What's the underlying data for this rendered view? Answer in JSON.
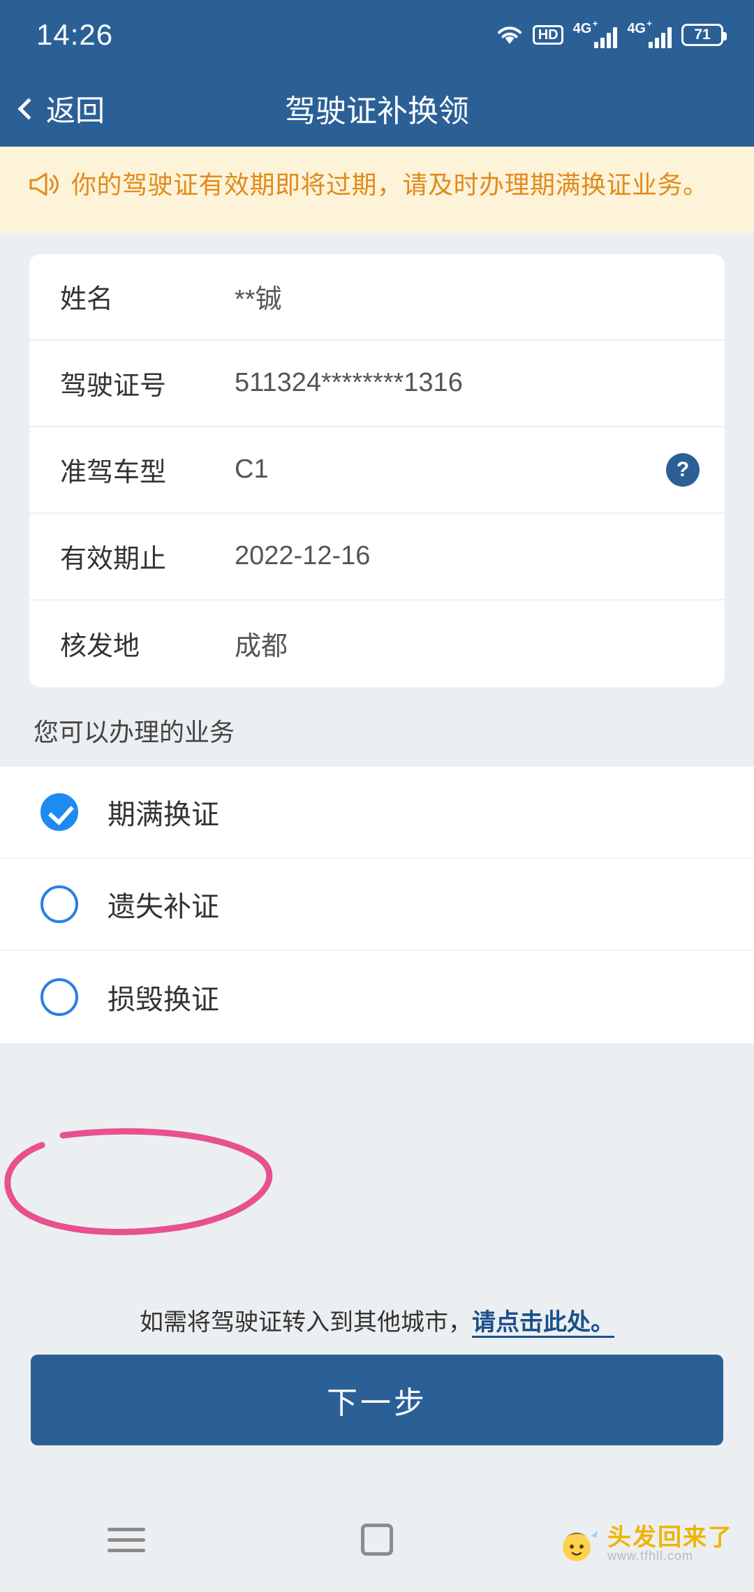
{
  "status_bar": {
    "time": "14:26",
    "wifi_icon": "wifi-icon",
    "hd_label": "HD",
    "net_label_1": "4G",
    "net_sup_1": "+",
    "net_label_2": "4G",
    "net_sup_2": "+",
    "battery": "71"
  },
  "app_bar": {
    "back_label": "返回",
    "title": "驾驶证补换领"
  },
  "notice": {
    "icon": "megaphone-icon",
    "text": "你的驾驶证有效期即将过期，请及时办理期满换证业务。"
  },
  "info_card": {
    "rows": [
      {
        "label": "姓名",
        "value": "**铖",
        "help": ""
      },
      {
        "label": "驾驶证号",
        "value": "511324********1316",
        "help": ""
      },
      {
        "label": "准驾车型",
        "value": "C1",
        "help": "?"
      },
      {
        "label": "有效期止",
        "value": "2022-12-16",
        "help": ""
      },
      {
        "label": "核发地",
        "value": "成都",
        "help": ""
      }
    ]
  },
  "section": {
    "title": "您可以办理的业务"
  },
  "options": [
    {
      "label": "期满换证",
      "checked": true
    },
    {
      "label": "遗失补证",
      "checked": false
    },
    {
      "label": "损毁换证",
      "checked": false
    }
  ],
  "bottom": {
    "note_prefix": "如需将驾驶证转入到其他城市，",
    "note_link": "请点击此处。",
    "next_label": "下一步"
  },
  "nav_bar": {
    "menu_icon": "menu-icon",
    "home_icon": "home-square-icon"
  },
  "watermark": {
    "main": "头发回来了",
    "sub": "www.tfhll.com"
  },
  "colors": {
    "brand": "#2b6097",
    "notice_bg": "#fdf3d8",
    "notice_text": "#e08b1e",
    "accent": "#1d8bf1",
    "annotation": "#e8508f"
  }
}
